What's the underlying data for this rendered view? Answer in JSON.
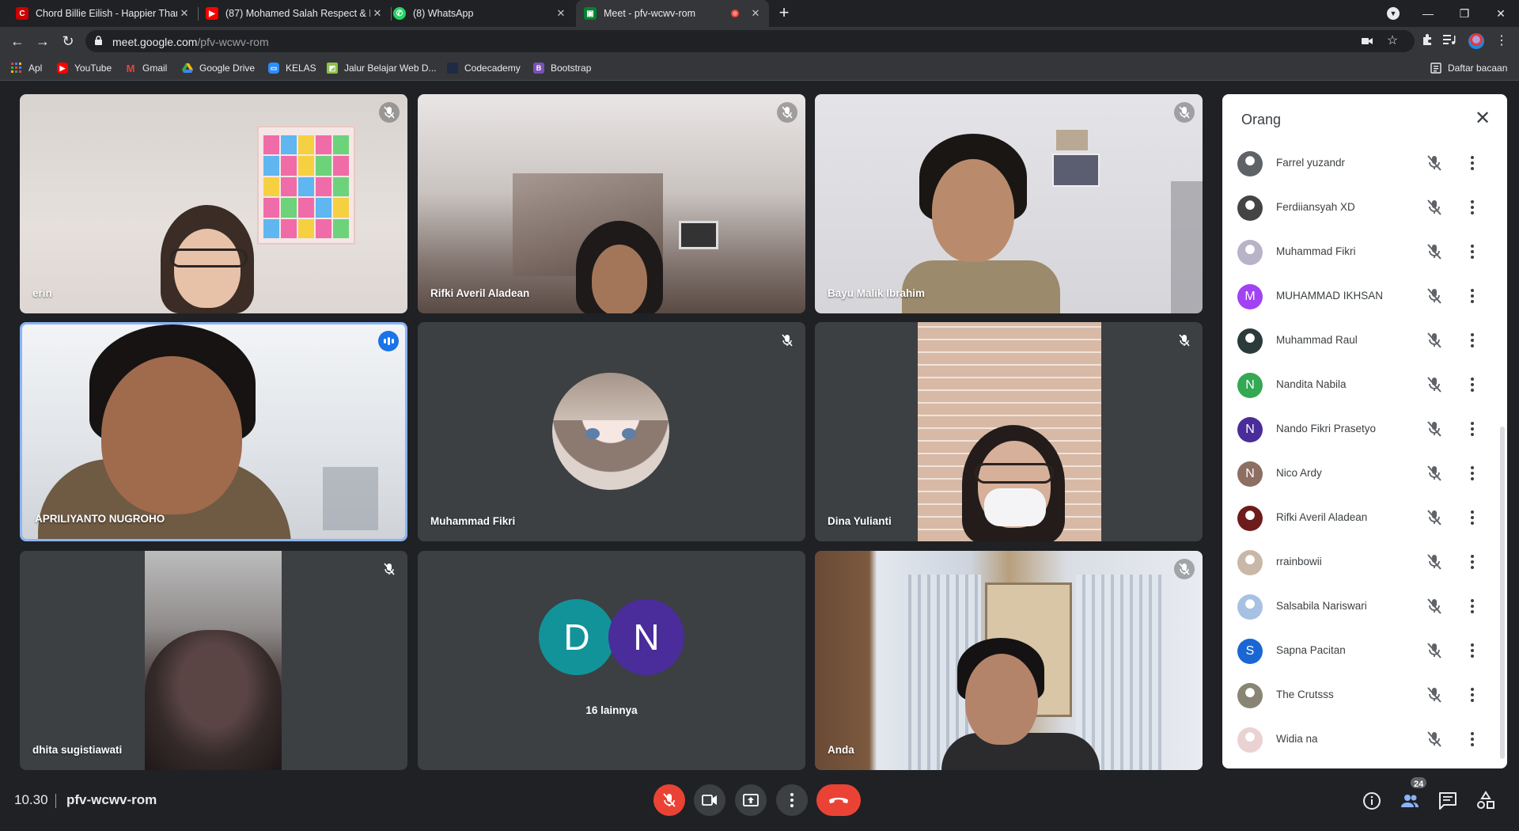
{
  "browser": {
    "tabs": [
      {
        "title": "Chord Billie Eilish - Happier Than",
        "icon": "chordtela-icon",
        "color": "#cc0000"
      },
      {
        "title": "(87) Mohamed Salah Respect & E",
        "icon": "youtube-icon",
        "color": "#ff0000"
      },
      {
        "title": "(8) WhatsApp",
        "icon": "whatsapp-icon",
        "color": "#25d366"
      },
      {
        "title": "Meet - pfv-wcwv-rom",
        "icon": "meet-icon",
        "color": "#00832d",
        "active": true
      }
    ],
    "url_host": "meet.google.com",
    "url_path": "/pfv-wcwv-rom",
    "bookmarks": [
      {
        "label": "Apl",
        "icon": "apps-icon"
      },
      {
        "label": "YouTube",
        "icon": "youtube-icon"
      },
      {
        "label": "Gmail",
        "icon": "gmail-icon"
      },
      {
        "label": "Google Drive",
        "icon": "drive-icon"
      },
      {
        "label": "KELAS",
        "icon": "zoom-icon"
      },
      {
        "label": "Jalur Belajar Web D...",
        "icon": "dicoding-icon"
      },
      {
        "label": "Codecademy",
        "icon": "codecademy-icon"
      },
      {
        "label": "Bootstrap",
        "icon": "bootstrap-icon"
      }
    ],
    "reading_list": "Daftar bacaan"
  },
  "tiles": [
    {
      "name": "erin",
      "muted": true
    },
    {
      "name": "Rifki Averil Aladean",
      "muted": true
    },
    {
      "name": "Bayu Malik Ibrahim",
      "muted": true
    },
    {
      "name": "APRILIYANTO NUGROHO",
      "muted": false,
      "speaking": true
    },
    {
      "name": "Muhammad Fikri",
      "muted": true
    },
    {
      "name": "Dina Yulianti",
      "muted": true
    },
    {
      "name": "dhita sugistiawati",
      "muted": true
    },
    {
      "name": "",
      "others_label": "16 lainnya",
      "initials": [
        "D",
        "N"
      ]
    },
    {
      "name": "Anda",
      "muted": true
    }
  ],
  "people_panel": {
    "title": "Orang",
    "participants": [
      {
        "name": "Farrel yuzandr",
        "avatar": "photo",
        "color": "#5f6368"
      },
      {
        "name": "Ferdiiansyah XD",
        "avatar": "photo",
        "color": "#444"
      },
      {
        "name": "Muhammad Fikri",
        "avatar": "photo",
        "color": "#b9b3c8"
      },
      {
        "name": "MUHAMMAD IKHSAN",
        "avatar": "M",
        "color": "#a142f4"
      },
      {
        "name": "Muhammad Raul",
        "avatar": "photo",
        "color": "#2b3a3a"
      },
      {
        "name": "Nandita Nabila",
        "avatar": "N",
        "color": "#34a853"
      },
      {
        "name": "Nando Fikri Prasetyo",
        "avatar": "N",
        "color": "#4a2c9b"
      },
      {
        "name": "Nico Ardy",
        "avatar": "N",
        "color": "#8d6e63"
      },
      {
        "name": "Rifki Averil Aladean",
        "avatar": "photo",
        "color": "#6d1b1b"
      },
      {
        "name": "rrainbowii",
        "avatar": "photo",
        "color": "#c9b8a8"
      },
      {
        "name": "Salsabila Nariswari",
        "avatar": "photo",
        "color": "#a7c1e3"
      },
      {
        "name": "Sapna Pacitan",
        "avatar": "S",
        "color": "#1967d2"
      },
      {
        "name": "The Crutsss",
        "avatar": "photo",
        "color": "#8a8474"
      },
      {
        "name": "Widia na",
        "avatar": "photo",
        "color": "#ead2d2"
      }
    ]
  },
  "bottom": {
    "time": "10.30",
    "meeting_code": "pfv-wcwv-rom",
    "people_count": "24"
  }
}
